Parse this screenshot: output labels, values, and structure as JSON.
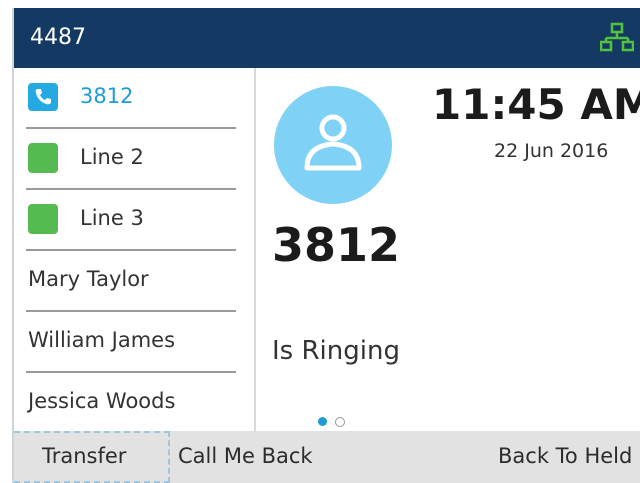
{
  "header": {
    "extension": "4487",
    "network_icon": "network-icon",
    "bar_color": "#143a64",
    "network_icon_color": "#52c23e"
  },
  "sidebar": {
    "items": [
      {
        "label": "3812",
        "icon": "phone-icon",
        "state": "active"
      },
      {
        "label": "Line 2",
        "icon": "line-status-icon"
      },
      {
        "label": "Line 3",
        "icon": "line-status-icon"
      },
      {
        "label": "Mary Taylor"
      },
      {
        "label": "William James"
      },
      {
        "label": "Jessica Woods"
      }
    ],
    "active_color": "#1e9bd7",
    "line_color": "#55bb50"
  },
  "call": {
    "time": "11:45 AM",
    "date": "22 Jun 2016",
    "number": "3812",
    "status": "Is Ringing",
    "avatar_icon": "user-avatar-icon",
    "avatar_color": "#7fd1f6",
    "page_current": 1,
    "page_total": 2
  },
  "softkeys": {
    "transfer": "Transfer",
    "call_me_back": "Call Me Back",
    "back_to_held": "Back To Held"
  }
}
